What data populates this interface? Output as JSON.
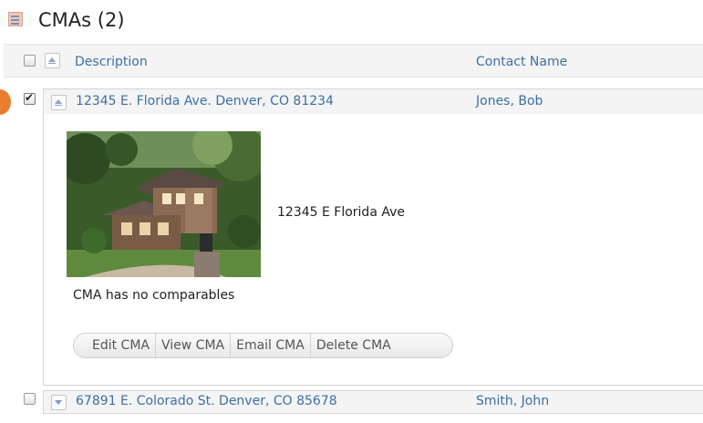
{
  "section": {
    "title": "CMAs (2)"
  },
  "table": {
    "columns": [
      "Description",
      "Contact Name"
    ]
  },
  "records": [
    {
      "description": "12345 E. Florida Ave. Denver, CO 81234",
      "contact": "Jones, Bob",
      "checked": true,
      "expanded": true,
      "photo_caption": "12345 E Florida Ave",
      "comparables_note": "CMA has no comparables",
      "actions": [
        "Edit CMA",
        "View CMA",
        "Email CMA",
        "Delete CMA"
      ]
    },
    {
      "description": "67891 E. Colorado St. Denver, CO 85678",
      "contact": "Smith, John",
      "checked": false,
      "expanded": false
    }
  ],
  "colors": {
    "link": "#3b6fa6",
    "header_bg": "#f4f4f4",
    "callout": "#e87e2e"
  },
  "icons": {
    "title": "document-list-icon",
    "sort_header": "sort-up-icon",
    "expanded_row": "collapse-up-icon",
    "collapsed_row": "expand-down-icon",
    "checkbox": "checkbox-icon"
  }
}
